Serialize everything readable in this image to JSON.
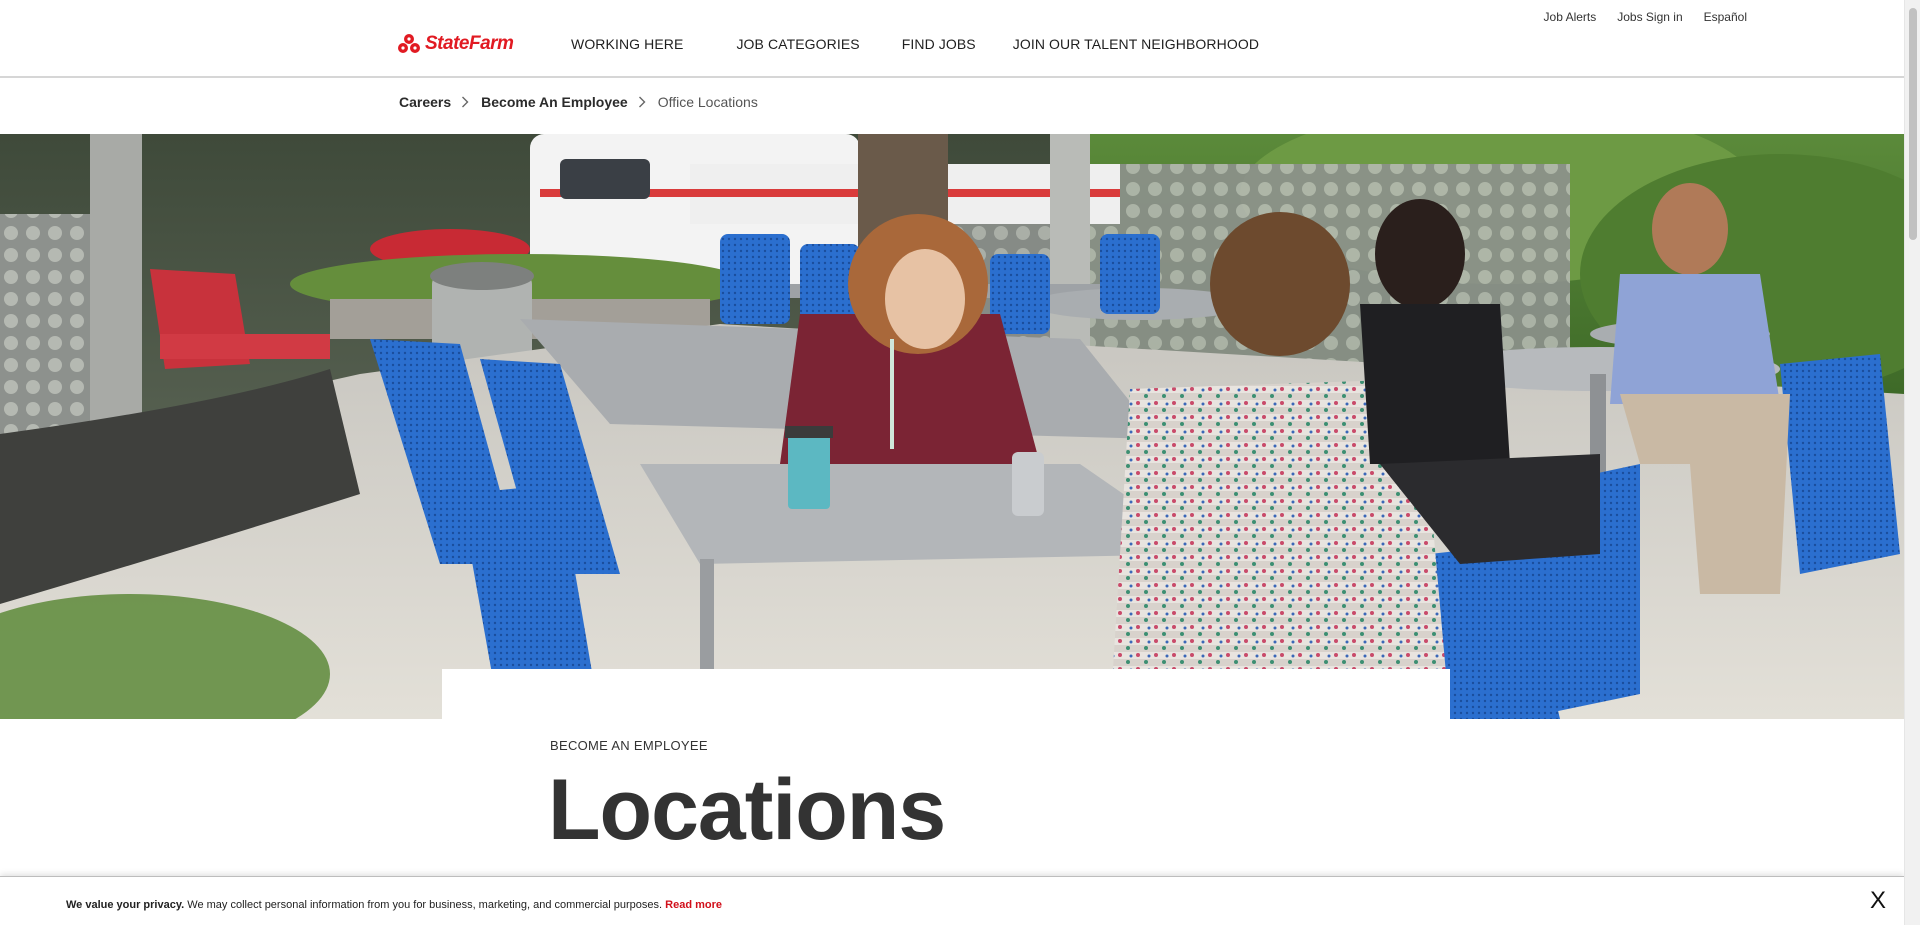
{
  "brand": {
    "name": "StateFarm",
    "color": "#e11a22",
    "logo_icon": "three-ovals-logo-icon"
  },
  "main_nav": [
    {
      "label": "WORKING HERE"
    },
    {
      "label": "JOB CATEGORIES"
    },
    {
      "label": "FIND JOBS"
    },
    {
      "label": "JOIN OUR TALENT NEIGHBORHOOD"
    }
  ],
  "util_nav": [
    {
      "label": "Job Alerts"
    },
    {
      "label": "Jobs Sign in"
    },
    {
      "label": "Español"
    }
  ],
  "breadcrumb": {
    "items": [
      {
        "label": "Careers"
      },
      {
        "label": "Become An Employee"
      }
    ],
    "current": "Office Locations"
  },
  "hero": {
    "image": "outdoor-patio-employees-photo"
  },
  "content": {
    "eyebrow": "BECOME AN EMPLOYEE",
    "title": "Locations"
  },
  "privacy": {
    "bold": "We value your privacy.",
    "text": " We may collect personal information from you for business, marketing, and commercial purposes.",
    "link": "Read more",
    "close": "X",
    "link_color": "#d10f1a"
  }
}
